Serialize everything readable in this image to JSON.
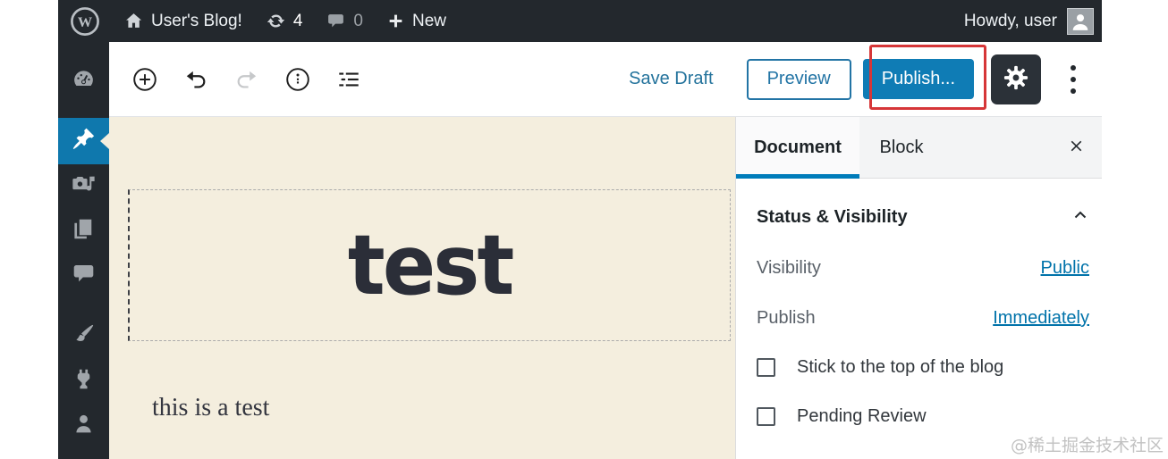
{
  "admin_bar": {
    "site_name": "User's Blog!",
    "update_count": "4",
    "comment_count": "0",
    "new_label": "New",
    "howdy": "Howdy, user"
  },
  "sidebar": {
    "items": [
      "dashboard",
      "posts",
      "media",
      "pages",
      "comments",
      "appearance",
      "plugins",
      "users"
    ],
    "active": "posts"
  },
  "toolbar": {
    "save_draft_label": "Save Draft",
    "preview_label": "Preview",
    "publish_label": "Publish...",
    "icons": [
      "add-block",
      "undo",
      "redo",
      "info",
      "list-view",
      "settings-gear",
      "more-menu"
    ]
  },
  "editor": {
    "title": "test",
    "body": "this is a test"
  },
  "panel": {
    "tabs": {
      "document": "Document",
      "block": "Block"
    },
    "section_title": "Status & Visibility",
    "rows": [
      {
        "label": "Visibility",
        "value": "Public"
      },
      {
        "label": "Publish",
        "value": "Immediately"
      }
    ],
    "checkboxes": [
      {
        "label": "Stick to the top of the blog",
        "checked": false
      },
      {
        "label": "Pending Review",
        "checked": false
      }
    ]
  },
  "annotation": {
    "type": "red-highlight-box",
    "target": "publish-button",
    "color": "#d63638"
  },
  "colors": {
    "admin_dark": "#23282d",
    "active_menu_blue": "#0f78ad",
    "primary_button_blue": "#0f7cb5",
    "link_blue": "#0073aa",
    "tab_underline_blue": "#007cba",
    "canvas_beige": "#f4eede",
    "annotation_red": "#d63638"
  },
  "watermark": "@稀土掘金技术社区"
}
